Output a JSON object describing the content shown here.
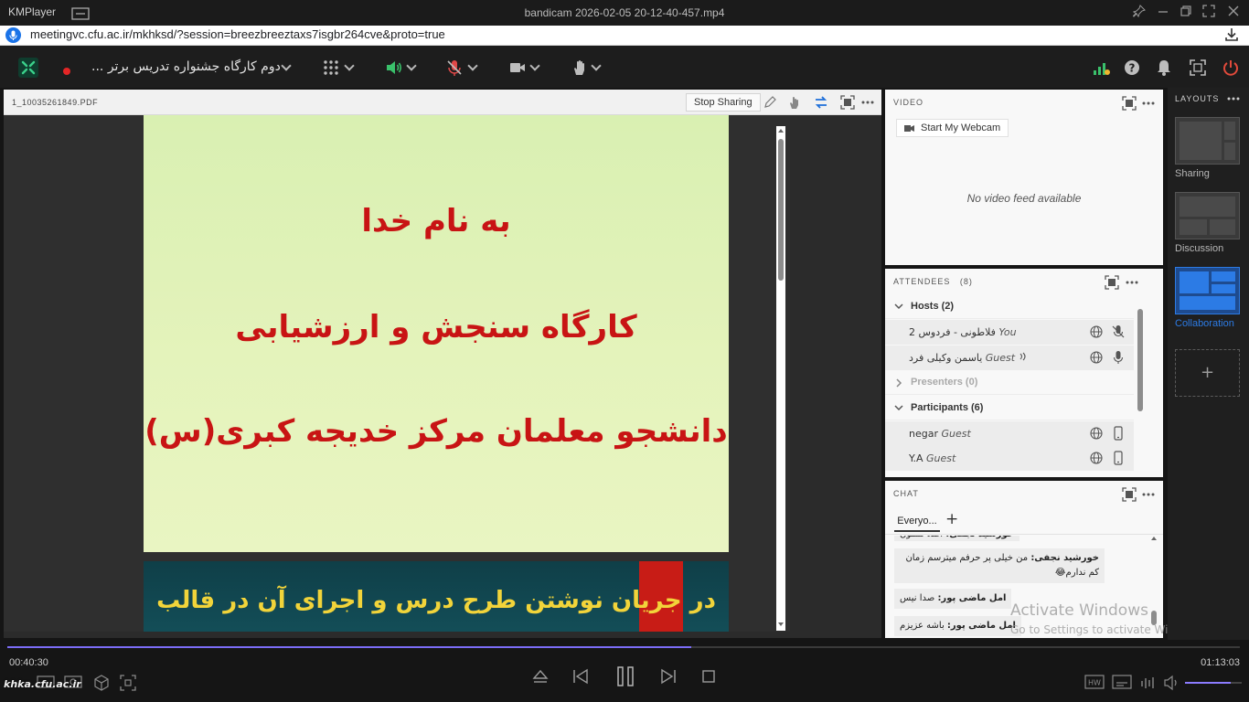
{
  "player": {
    "app_name": "KMPlayer",
    "file_name": "bandicam 2026-02-05 20-12-40-457.mp4",
    "time_current": "00:40:30",
    "time_total": "01:13:03",
    "progress_fraction": 0.555,
    "volume_fraction": 0.8
  },
  "browser": {
    "url": "meetingvc.cfu.ac.ir/mkhksd/?session=breezbreeztaxs7isgbr264cve&proto=true"
  },
  "toolbar": {
    "meeting_name": "... دوم کارگاه جشنواره تدریس برتر"
  },
  "share_pod": {
    "file_name": "1_10035261849.PDF",
    "stop_sharing_label": "Stop Sharing",
    "slide1": {
      "line1": "به نام خدا",
      "line2": "کارگاه سنجش و ارزشیابی",
      "line3": "دانشجو معلمان مرکز خدیجه کبری(س)"
    },
    "slide2": {
      "line1": "در جریان نوشتن طرح درس و اجرای آن در قالب"
    }
  },
  "video_pod": {
    "title": "VIDEO",
    "webcam_button": "Start My Webcam",
    "no_video_text": "No video feed available"
  },
  "attendees_pod": {
    "title": "ATTENDEES",
    "count": "(8)",
    "hosts_label": "Hosts (2)",
    "presenters_label": "Presenters (0)",
    "participants_label": "Participants (6)",
    "hosts": [
      {
        "name": "2 فلاطونی - فردوس",
        "role": "You"
      },
      {
        "name": "یاسمن وکیلی فرد",
        "role": "Guest"
      }
    ],
    "participants": [
      {
        "name": "negar",
        "role": "Guest"
      },
      {
        "name": "Y.A",
        "role": "Guest"
      }
    ]
  },
  "chat_pod": {
    "title": "CHAT",
    "tab_label": "Everyo...",
    "add_label": "+",
    "messages": [
      {
        "sender": "خورشید نجفی:",
        "text": "اصلا ممنون"
      },
      {
        "sender": "خورشید نجفی:",
        "text": "من خیلی پر حرفم میترسم زمان کم ندارم😂"
      },
      {
        "sender": "امل ماضی پور:",
        "text": "صدا نیس"
      },
      {
        "sender": "امل ماضی پور:",
        "text": "باشه عزیزم"
      }
    ]
  },
  "layouts": {
    "title": "LAYOUTS",
    "items": [
      "Sharing",
      "Discussion",
      "Collaboration"
    ],
    "add_label": "+"
  },
  "watermark": {
    "activate_title": "Activate Windows",
    "activate_sub": "Go to Settings to activate Windows.",
    "site_logo": "khka.cfu.ac.ir"
  },
  "colors": {
    "accent_blue": "#1a73e8",
    "collab_blue": "#2c7be5",
    "record_red": "#e32626",
    "slide_red": "#c81414",
    "seek_purple": "#7b6cf6",
    "power_red": "#e24a3b"
  }
}
